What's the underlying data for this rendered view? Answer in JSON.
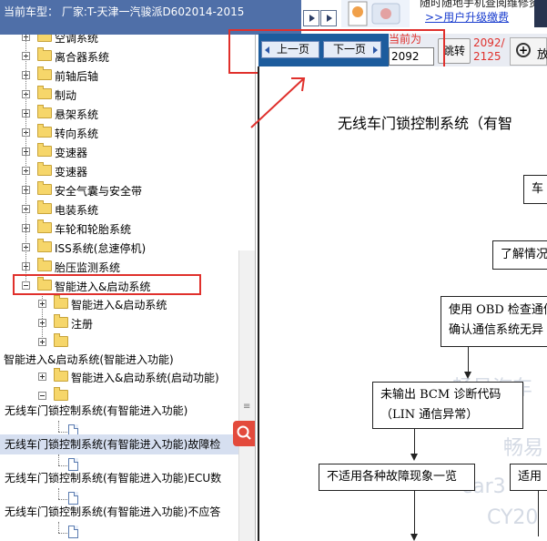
{
  "header": {
    "vehicle_label": "当前车型：",
    "vehicle_value": "厂家:T-天津一汽骏派D602014-2015"
  },
  "tree": {
    "top_items": [
      "空调系统",
      "离合器系统",
      "前轴后轴",
      "制动",
      "悬架系统",
      "转向系统",
      "变速器",
      "变速器",
      "安全气囊与安全带",
      "电装系统",
      "车轮和轮胎系统",
      "ISS系统(怠速停机)",
      "胎压监测系统"
    ],
    "selected_folder": "智能进入&启动系统",
    "child_folders": [
      "智能进入&启动系统",
      "注册"
    ],
    "section_heading": "智能进入&启动系统(智能进入功能)",
    "section_child": "智能进入&启动系统(启动功能)",
    "documents": [
      "无线车门锁控制系统(有智能进入功能)",
      "无线车门锁控制系统(有智能进入功能)故障检",
      "无线车门锁控制系统(有智能进入功能)ECU数",
      "无线车门锁控制系统(有智能进入功能)不应答"
    ]
  },
  "ad": {
    "line1": "随时随地手机查阅维修资",
    "line2": ">>用户升级缴费"
  },
  "toolbar": {
    "prev_label": "上一页",
    "next_label": "下一页",
    "current_label": "当前为",
    "current_page": "2092",
    "go_label": "跳转",
    "page_count_line1": "2092/",
    "page_count_line2": "2125",
    "zoom_label": "放"
  },
  "document": {
    "title": "无线车门锁控制系统（有智",
    "boxes": [
      "车",
      "了解情况",
      "使用 OBD 检查通信",
      "确认通信系统无异",
      "未输出 BCM 诊断代码",
      "（LIN 通信异常）",
      "不适用各种故障现象一览",
      "适用"
    ],
    "watermarks": [
      "畅易汽车",
      "畅易",
      "car3",
      "CY20"
    ]
  },
  "colors": {
    "accent_red": "#e0302c",
    "nav_blue": "#1d5c9d",
    "header_blue": "#4f6fa8"
  }
}
